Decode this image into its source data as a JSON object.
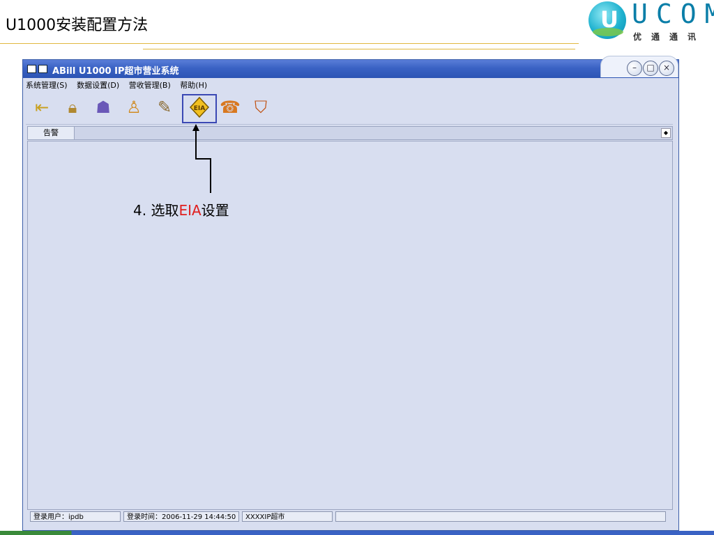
{
  "slide": {
    "title": "U1000安装配置方法"
  },
  "logo": {
    "letters": "UCOM",
    "subtitle": "优通通讯"
  },
  "window": {
    "title": "ABill U1000 IP超市营业系统",
    "controls": {
      "minimize": "–",
      "maximize": "□",
      "close": "×"
    }
  },
  "menubar": {
    "items": [
      "系统管理(S)",
      "数据设置(D)",
      "营收管理(B)",
      "帮助(H)"
    ]
  },
  "toolbar": {
    "icons": [
      "exit-icon",
      "lock-icon",
      "users-icon",
      "user-icon",
      "pencil-icon",
      "eia-icon",
      "telephone-icon",
      "shield-icon"
    ],
    "eia_label": "EIA"
  },
  "tabbar": {
    "tab": "告警"
  },
  "statusbar": {
    "user": "登录用户：ipdb",
    "time": "登录时间：2006-11-29 14:44:50",
    "store": "XXXXIP超市",
    "extra": ""
  },
  "annotation": {
    "prefix": "4. 选取",
    "highlight": "EIA",
    "suffix": "设置",
    "highlight_color": "#e01e1e"
  }
}
